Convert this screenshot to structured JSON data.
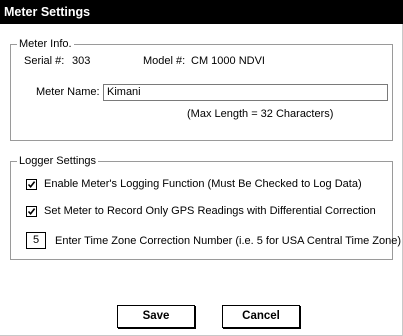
{
  "window": {
    "title": "Meter Settings"
  },
  "meter_info": {
    "legend": "Meter Info.",
    "serial_label": "Serial #:",
    "serial_value": "303",
    "model_label": "Model #:",
    "model_value": "CM 1000 NDVI",
    "name_label": "Meter Name:",
    "name_value": "Kimani",
    "name_hint": "(Max Length = 32 Characters)"
  },
  "logger_settings": {
    "legend": "Logger Settings",
    "enable_logging": {
      "label": "Enable Meter's Logging Function (Must Be Checked to Log Data)",
      "checked": true
    },
    "gps_only": {
      "label": "Set Meter to Record Only GPS Readings with Differential Correction",
      "checked": true
    },
    "timezone": {
      "value": "5",
      "label": "Enter Time Zone Correction Number (i.e. 5 for USA Central Time Zone)"
    }
  },
  "buttons": {
    "save": "Save",
    "cancel": "Cancel"
  }
}
